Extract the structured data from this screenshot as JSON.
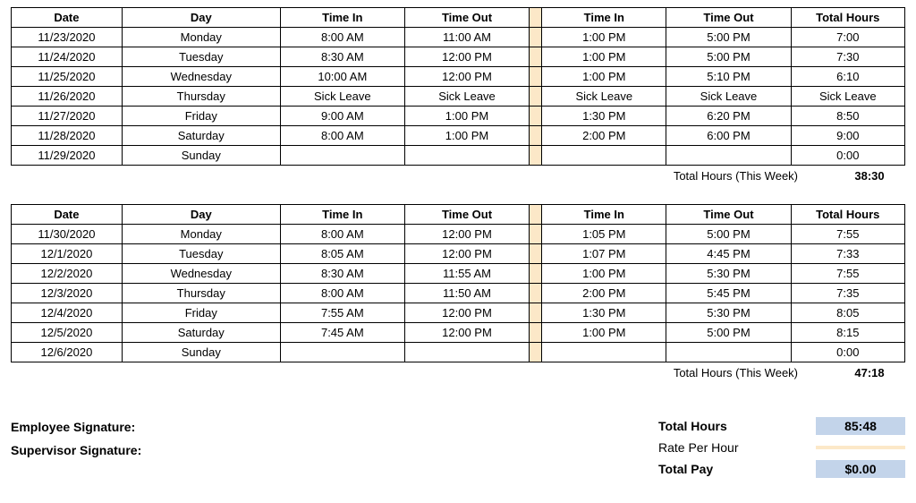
{
  "headers": {
    "date": "Date",
    "day": "Day",
    "time_in": "Time In",
    "time_out": "Time Out",
    "total_hours": "Total Hours"
  },
  "week1": {
    "rows": [
      {
        "date": "11/23/2020",
        "day": "Monday",
        "in1": "8:00 AM",
        "out1": "11:00 AM",
        "in2": "1:00 PM",
        "out2": "5:00 PM",
        "total": "7:00"
      },
      {
        "date": "11/24/2020",
        "day": "Tuesday",
        "in1": "8:30 AM",
        "out1": "12:00 PM",
        "in2": "1:00 PM",
        "out2": "5:00 PM",
        "total": "7:30"
      },
      {
        "date": "11/25/2020",
        "day": "Wednesday",
        "in1": "10:00 AM",
        "out1": "12:00 PM",
        "in2": "1:00 PM",
        "out2": "5:10 PM",
        "total": "6:10"
      },
      {
        "date": "11/26/2020",
        "day": "Thursday",
        "in1": "Sick Leave",
        "out1": "Sick Leave",
        "in2": "Sick Leave",
        "out2": "Sick Leave",
        "total": "Sick Leave"
      },
      {
        "date": "11/27/2020",
        "day": "Friday",
        "in1": "9:00 AM",
        "out1": "1:00 PM",
        "in2": "1:30 PM",
        "out2": "6:20 PM",
        "total": "8:50"
      },
      {
        "date": "11/28/2020",
        "day": "Saturday",
        "in1": "8:00 AM",
        "out1": "1:00 PM",
        "in2": "2:00 PM",
        "out2": "6:00 PM",
        "total": "9:00"
      },
      {
        "date": "11/29/2020",
        "day": "Sunday",
        "in1": "",
        "out1": "",
        "in2": "",
        "out2": "",
        "total": "0:00"
      }
    ],
    "total_label": "Total Hours (This Week)",
    "total_value": "38:30"
  },
  "week2": {
    "rows": [
      {
        "date": "11/30/2020",
        "day": "Monday",
        "in1": "8:00 AM",
        "out1": "12:00 PM",
        "in2": "1:05 PM",
        "out2": "5:00 PM",
        "total": "7:55"
      },
      {
        "date": "12/1/2020",
        "day": "Tuesday",
        "in1": "8:05 AM",
        "out1": "12:00 PM",
        "in2": "1:07 PM",
        "out2": "4:45 PM",
        "total": "7:33"
      },
      {
        "date": "12/2/2020",
        "day": "Wednesday",
        "in1": "8:30 AM",
        "out1": "11:55 AM",
        "in2": "1:00 PM",
        "out2": "5:30 PM",
        "total": "7:55"
      },
      {
        "date": "12/3/2020",
        "day": "Thursday",
        "in1": "8:00 AM",
        "out1": "11:50 AM",
        "in2": "2:00 PM",
        "out2": "5:45 PM",
        "total": "7:35"
      },
      {
        "date": "12/4/2020",
        "day": "Friday",
        "in1": "7:55 AM",
        "out1": "12:00 PM",
        "in2": "1:30 PM",
        "out2": "5:30 PM",
        "total": "8:05"
      },
      {
        "date": "12/5/2020",
        "day": "Saturday",
        "in1": "7:45 AM",
        "out1": "12:00 PM",
        "in2": "1:00 PM",
        "out2": "5:00 PM",
        "total": "8:15"
      },
      {
        "date": "12/6/2020",
        "day": "Sunday",
        "in1": "",
        "out1": "",
        "in2": "",
        "out2": "",
        "total": "0:00"
      }
    ],
    "total_label": "Total Hours (This Week)",
    "total_value": "47:18"
  },
  "signatures": {
    "employee": "Employee Signature:",
    "supervisor": "Supervisor Signature:"
  },
  "summary": {
    "total_hours_label": "Total Hours",
    "total_hours_value": "85:48",
    "rate_label": "Rate Per Hour",
    "rate_value": "",
    "total_pay_label": "Total Pay",
    "total_pay_value": "$0.00"
  }
}
